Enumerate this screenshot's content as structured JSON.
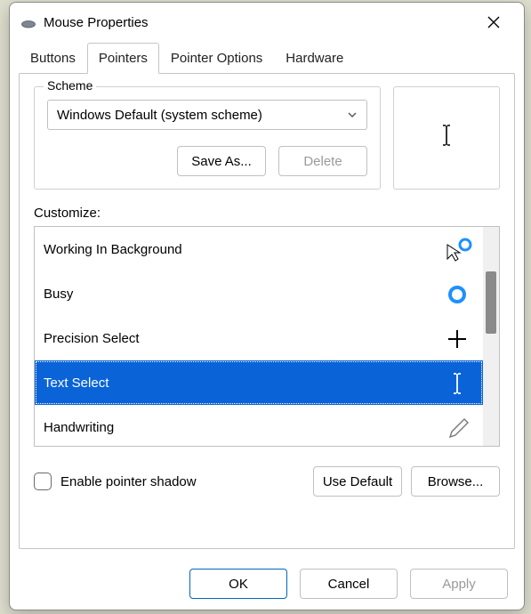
{
  "window": {
    "title": "Mouse Properties"
  },
  "tabs": [
    {
      "label": "Buttons",
      "active": false
    },
    {
      "label": "Pointers",
      "active": true
    },
    {
      "label": "Pointer Options",
      "active": false
    },
    {
      "label": "Hardware",
      "active": false
    }
  ],
  "scheme": {
    "legend": "Scheme",
    "selected": "Windows Default (system scheme)",
    "save_as": "Save As...",
    "delete": "Delete"
  },
  "customize_label": "Customize:",
  "pointer_list": [
    {
      "label": "Working In Background",
      "icon": "arrow-ring",
      "selected": false
    },
    {
      "label": "Busy",
      "icon": "ring",
      "selected": false
    },
    {
      "label": "Precision Select",
      "icon": "cross",
      "selected": false
    },
    {
      "label": "Text Select",
      "icon": "ibeam",
      "selected": true
    },
    {
      "label": "Handwriting",
      "icon": "pen",
      "selected": false
    }
  ],
  "shadow": {
    "label": "Enable pointer shadow",
    "checked": false
  },
  "buttons": {
    "use_default": "Use Default",
    "browse": "Browse...",
    "ok": "OK",
    "cancel": "Cancel",
    "apply": "Apply"
  },
  "preview_icon": "ibeam"
}
